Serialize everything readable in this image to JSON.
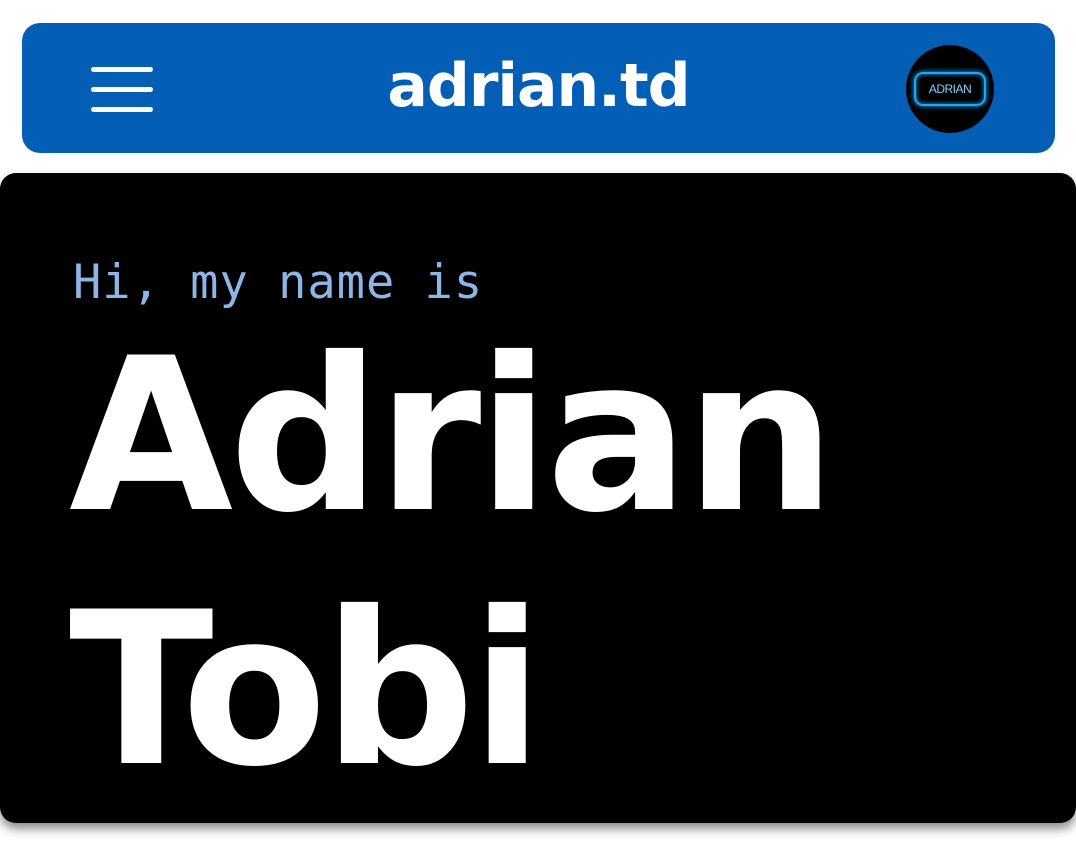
{
  "header": {
    "brand": "adrian.td",
    "menu_icon": "hamburger-menu-icon",
    "avatar_label": "ADRIAN",
    "background_color": "#035eb5"
  },
  "hero": {
    "greeting": "Hi, my name is",
    "first_name": "Adrian",
    "last_name": "Tobi",
    "greeting_color": "#8db5e6",
    "background_color": "#000000",
    "text_color": "#ffffff"
  }
}
